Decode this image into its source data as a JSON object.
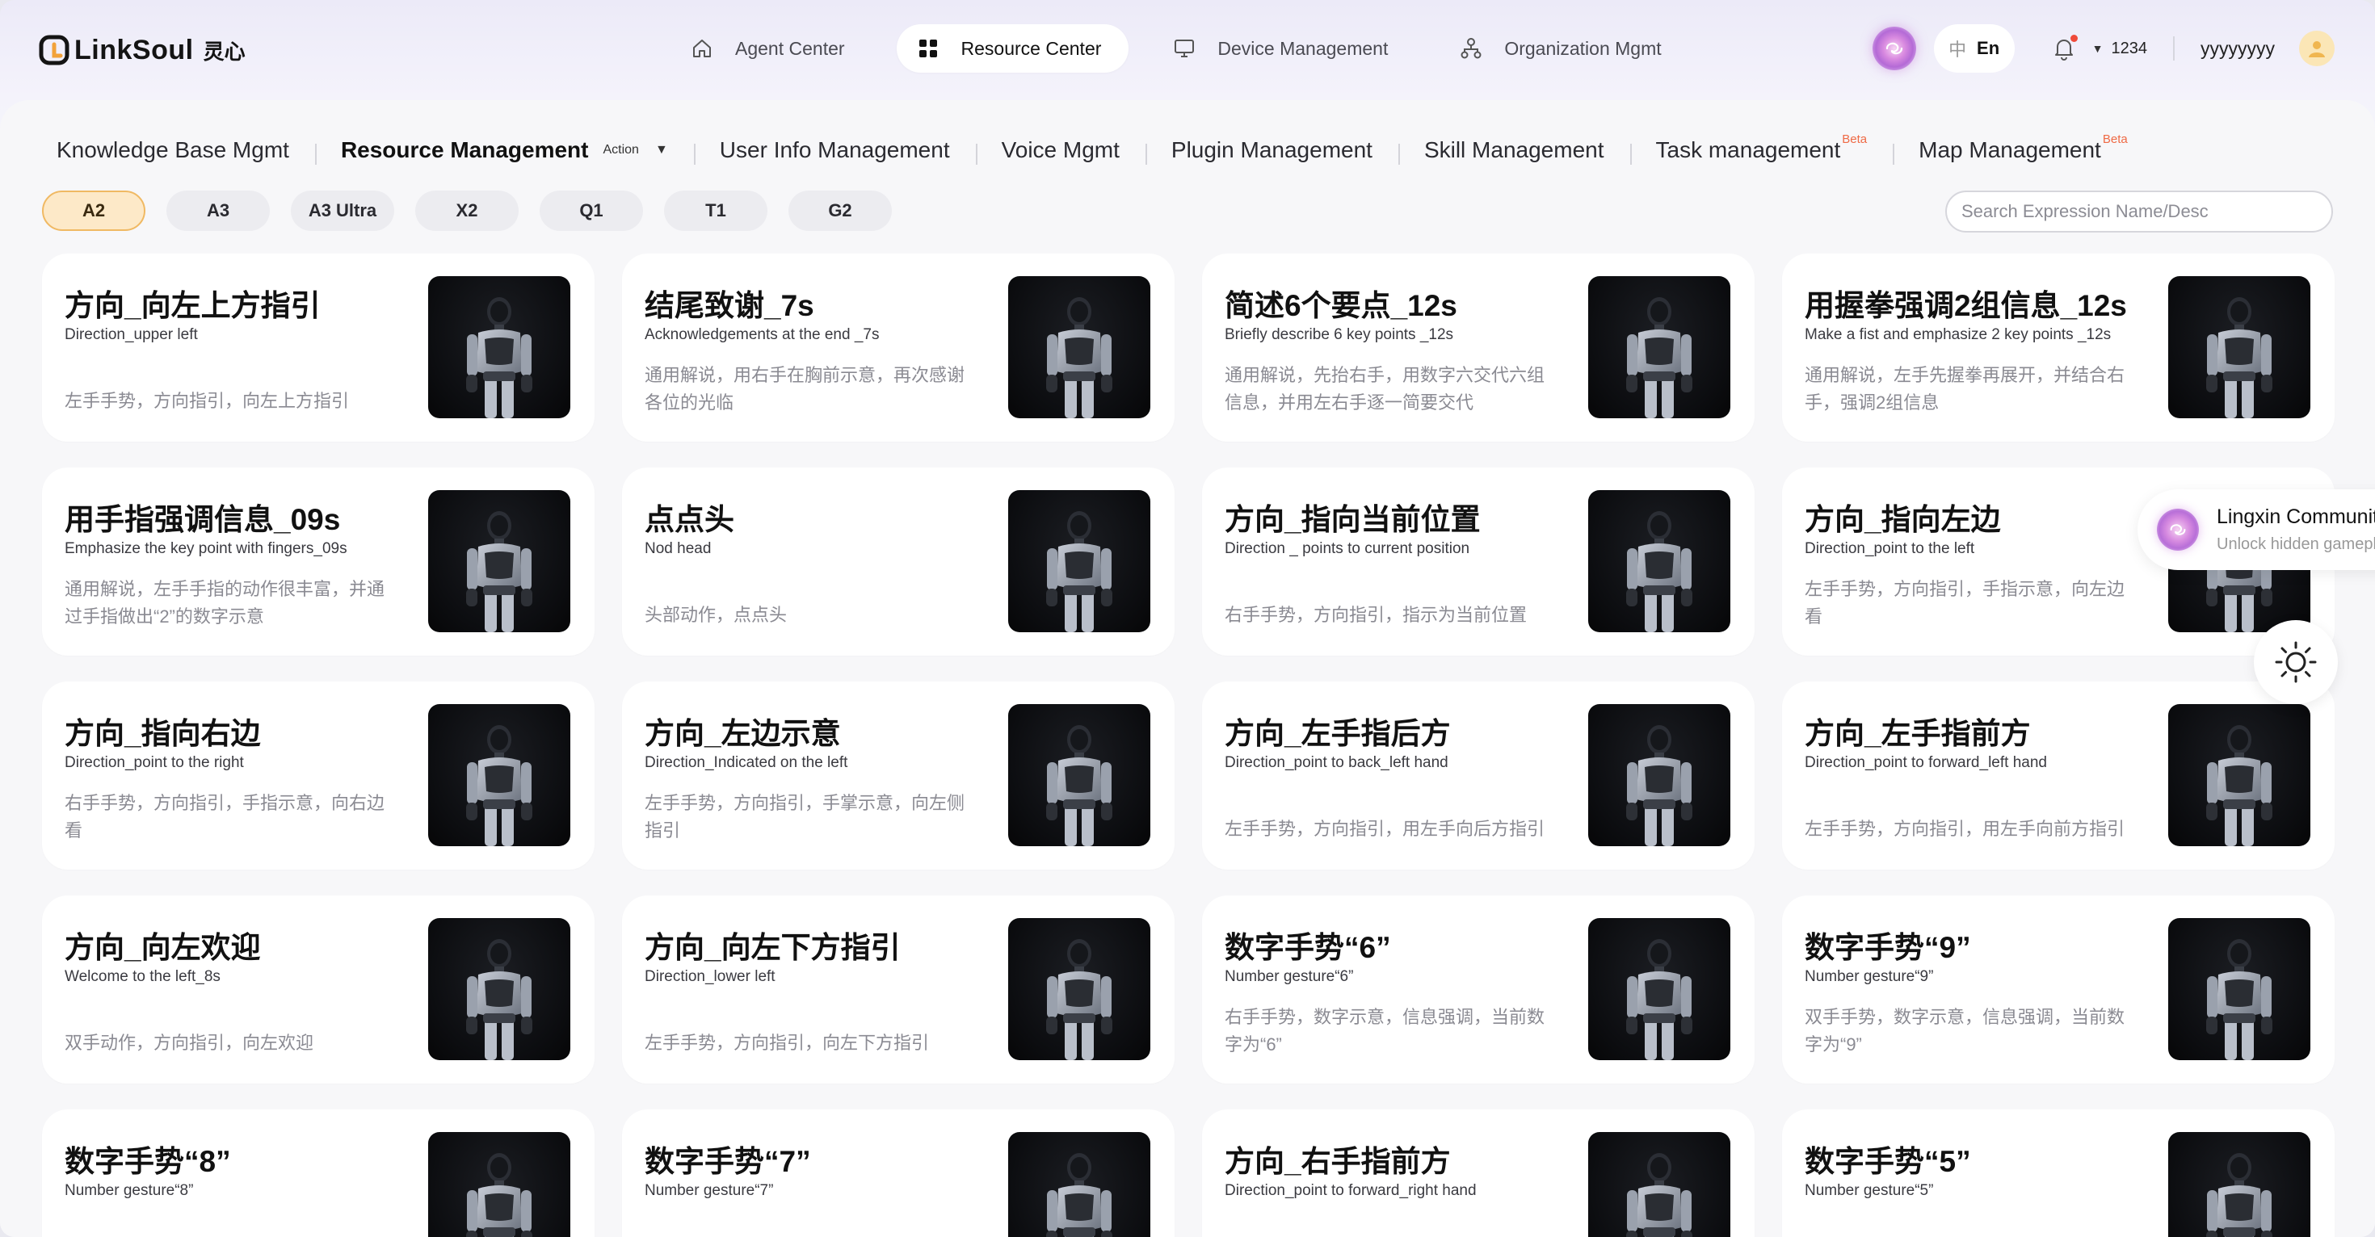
{
  "brand": {
    "name": "LinkSoul",
    "name_cn": "灵心"
  },
  "nav": {
    "items": [
      {
        "label": "Agent Center",
        "icon": "home-icon"
      },
      {
        "label": "Resource Center",
        "icon": "grid-icon"
      },
      {
        "label": "Device Management",
        "icon": "monitor-icon"
      },
      {
        "label": "Organization Mgmt",
        "icon": "org-icon"
      }
    ],
    "active": "Resource Center"
  },
  "header_right": {
    "lang_zh": "中",
    "lang_en": "En",
    "coins": "1234",
    "username": "yyyyyyyy"
  },
  "subtabs": {
    "items": [
      {
        "label": "Knowledge Base Mgmt"
      },
      {
        "label": "Resource Management",
        "action": "Action"
      },
      {
        "label": "User Info Management"
      },
      {
        "label": "Voice Mgmt"
      },
      {
        "label": "Plugin Management"
      },
      {
        "label": "Skill Management"
      },
      {
        "label": "Task management",
        "badge": "Beta"
      },
      {
        "label": "Map Management",
        "badge": "Beta"
      }
    ],
    "active": "Resource Management"
  },
  "chips": {
    "items": [
      "A2",
      "A3",
      "A3 Ultra",
      "X2",
      "Q1",
      "T1",
      "G2"
    ],
    "active": "A2"
  },
  "search": {
    "placeholder": "Search Expression Name/Desc"
  },
  "cards": [
    {
      "title": "方向_向左上方指引",
      "subtitle": "Direction_upper left",
      "desc": "左手手势，方向指引，向左上方指引"
    },
    {
      "title": "结尾致谢_7s",
      "subtitle": "Acknowledgements at the end _7s",
      "desc": "通用解说，用右手在胸前示意，再次感谢各位的光临"
    },
    {
      "title": "简述6个要点_12s",
      "subtitle": "Briefly describe 6 key points _12s",
      "desc": "通用解说，先抬右手，用数字六交代六组信息，并用左右手逐一简要交代"
    },
    {
      "title": "用握拳强调2组信息_12s",
      "subtitle": "Make a fist and emphasize 2 key points _12s",
      "desc": "通用解说，左手先握拳再展开，并结合右手，强调2组信息"
    },
    {
      "title": "用手指强调信息_09s",
      "subtitle": "Emphasize the key point with fingers_09s",
      "desc": "通用解说，左手手指的动作很丰富，并通过手指做出“2”的数字示意"
    },
    {
      "title": "点点头",
      "subtitle": "Nod head",
      "desc": "头部动作，点点头"
    },
    {
      "title": "方向_指向当前位置",
      "subtitle": "Direction _ points to current position",
      "desc": "右手手势，方向指引，指示为当前位置"
    },
    {
      "title": "方向_指向左边",
      "subtitle": "Direction_point to the left",
      "desc": "左手手势，方向指引，手指示意，向左边看"
    },
    {
      "title": "方向_指向右边",
      "subtitle": "Direction_point to the right",
      "desc": "右手手势，方向指引，手指示意，向右边看"
    },
    {
      "title": "方向_左边示意",
      "subtitle": "Direction_Indicated on the left",
      "desc": "左手手势，方向指引，手掌示意，向左侧指引"
    },
    {
      "title": "方向_左手指后方",
      "subtitle": "Direction_point to back_left hand",
      "desc": "左手手势，方向指引，用左手向后方指引"
    },
    {
      "title": "方向_左手指前方",
      "subtitle": "Direction_point to forward_left hand",
      "desc": "左手手势，方向指引，用左手向前方指引"
    },
    {
      "title": "方向_向左欢迎",
      "subtitle": "Welcome to the left_8s",
      "desc": "双手动作，方向指引，向左欢迎"
    },
    {
      "title": "方向_向左下方指引",
      "subtitle": "Direction_lower left",
      "desc": "左手手势，方向指引，向左下方指引"
    },
    {
      "title": "数字手势“6”",
      "subtitle": "Number gesture“6”",
      "desc": "右手手势，数字示意，信息强调，当前数字为“6”"
    },
    {
      "title": "数字手势“9”",
      "subtitle": "Number gesture“9”",
      "desc": "双手手势，数字示意，信息强调，当前数字为“9”"
    },
    {
      "title": "数字手势“8”",
      "subtitle": "Number gesture“8”",
      "desc": ""
    },
    {
      "title": "数字手势“7”",
      "subtitle": "Number gesture“7”",
      "desc": ""
    },
    {
      "title": "方向_右手指前方",
      "subtitle": "Direction_point to forward_right hand",
      "desc": ""
    },
    {
      "title": "数字手势“5”",
      "subtitle": "Number gesture“5”",
      "desc": ""
    }
  ],
  "floating": {
    "title": "Lingxin Community",
    "subtitle": "Unlock hidden gameplay"
  },
  "colors": {
    "accent_chip_bg": "#fde9c8",
    "accent_chip_border": "#f0b963",
    "beta": "#ef6a45",
    "notification_dot": "#ef4a3a"
  }
}
